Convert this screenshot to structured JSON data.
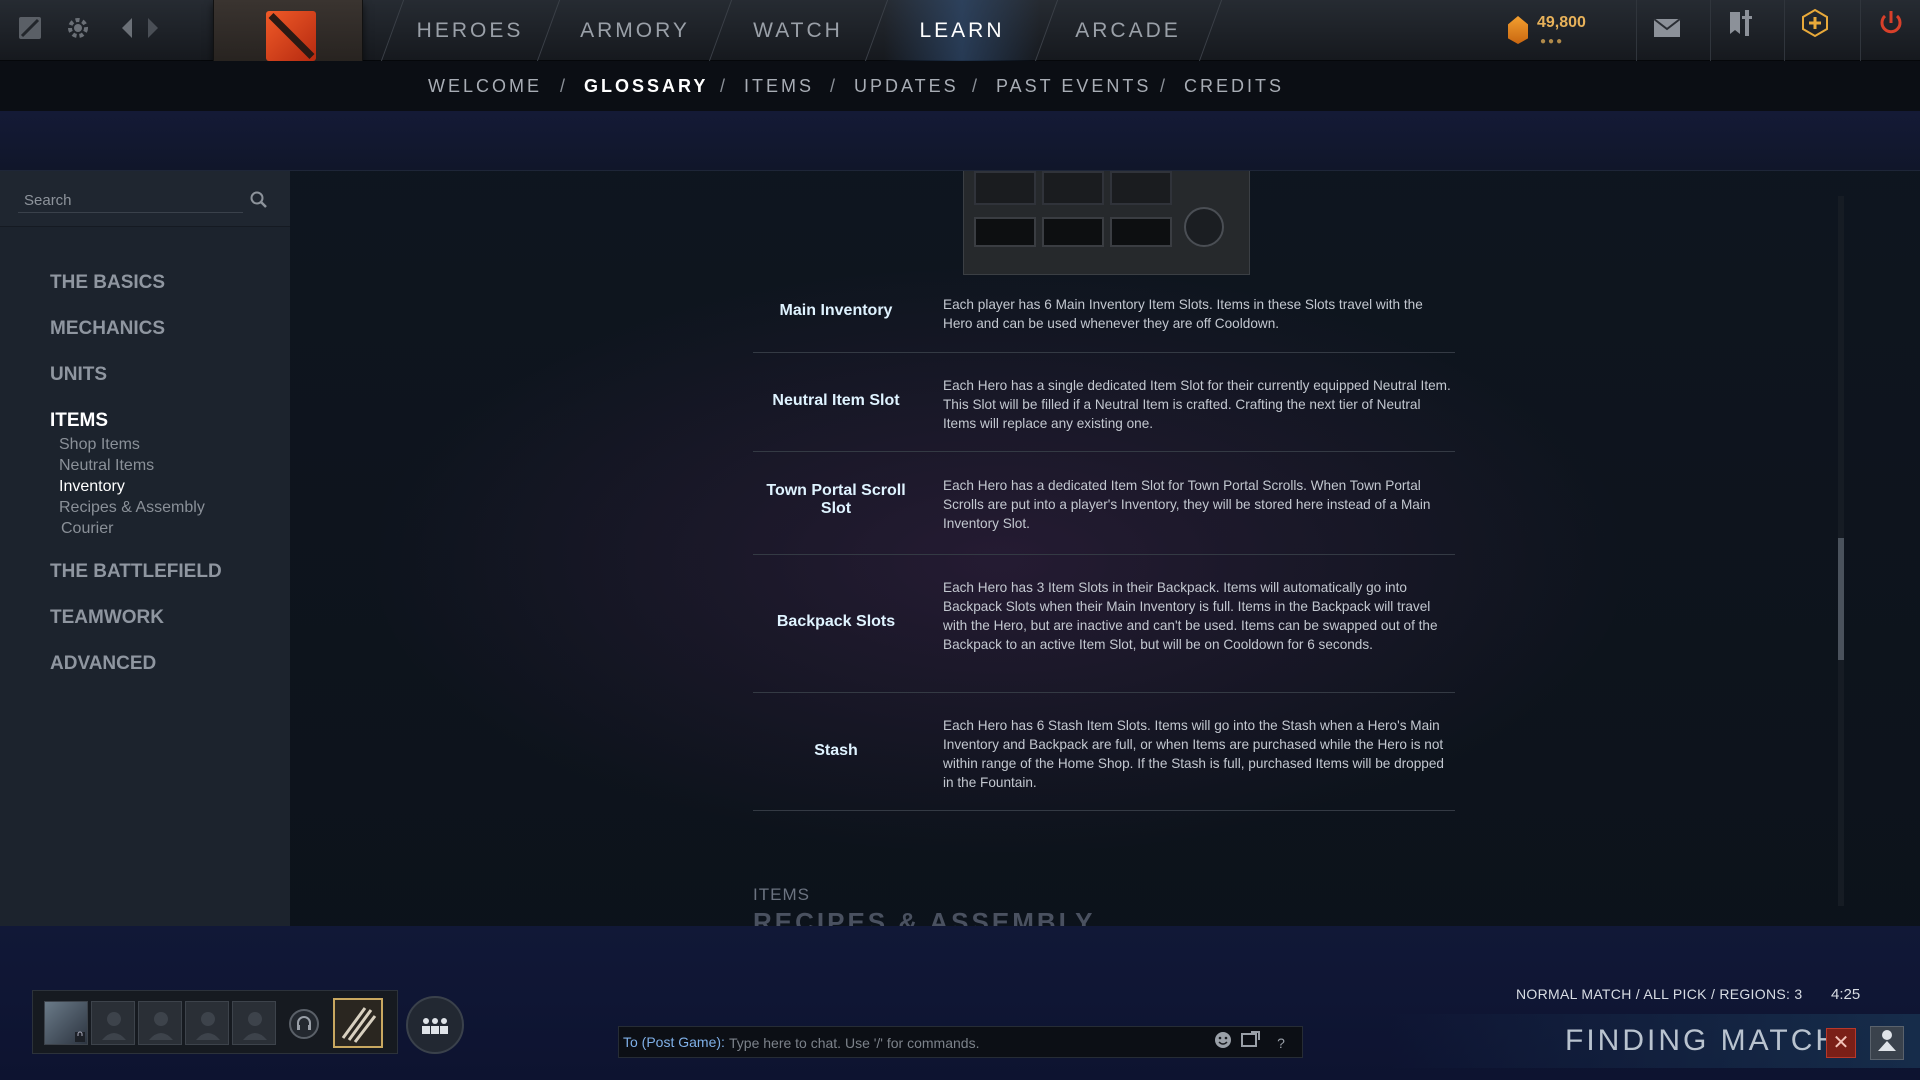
{
  "topnav": {
    "items": [
      {
        "label": "HEROES"
      },
      {
        "label": "ARMORY"
      },
      {
        "label": "WATCH"
      },
      {
        "label": "LEARN"
      },
      {
        "label": "ARCADE"
      }
    ],
    "active": "LEARN",
    "gold": "49,800"
  },
  "subnav": {
    "items": [
      {
        "label": "WELCOME"
      },
      {
        "label": "GLOSSARY"
      },
      {
        "label": "ITEMS"
      },
      {
        "label": "UPDATES"
      },
      {
        "label": "PAST EVENTS"
      },
      {
        "label": "CREDITS"
      }
    ],
    "separator": "/",
    "active": "GLOSSARY"
  },
  "sidebar": {
    "search_placeholder": "Search",
    "groups": [
      {
        "label": "THE BASICS"
      },
      {
        "label": "MECHANICS"
      },
      {
        "label": "UNITS"
      },
      {
        "label": "ITEMS"
      },
      {
        "label": "THE BATTLEFIELD"
      },
      {
        "label": "TEAMWORK"
      },
      {
        "label": "ADVANCED"
      }
    ],
    "items_subitems": [
      {
        "label": "Shop Items"
      },
      {
        "label": "Neutral Items"
      },
      {
        "label": "Inventory"
      },
      {
        "label": "Recipes & Assembly"
      },
      {
        "label": "Courier"
      }
    ],
    "active_group": "ITEMS",
    "active_sub": "Inventory"
  },
  "glossary": {
    "rows": [
      {
        "term": "Main Inventory",
        "desc": "Each player has 6 Main Inventory Item Slots.  Items in these Slots travel with the Hero and can be used whenever they are off Cooldown."
      },
      {
        "term": "Neutral Item Slot",
        "desc": "Each Hero has a single dedicated Item Slot for their currently equipped Neutral Item. This Slot will be filled if a Neutral Item is crafted. Crafting the next tier of Neutral Items will replace any existing one."
      },
      {
        "term": "Town Portal Scroll Slot",
        "desc": "Each Hero has a dedicated Item Slot for Town Portal Scrolls. When Town Portal Scrolls are put into a player's Inventory, they will be stored here instead of a Main Inventory Slot."
      },
      {
        "term": "Backpack Slots",
        "desc": "Each Hero has 3 Item Slots in their Backpack.  Items will automatically go into Backpack Slots when their Main Inventory is full. Items in the Backpack will travel with the Hero, but are inactive and can't be used.  Items can be swapped out of the Backpack to an active Item Slot, but will be on Cooldown for 6 seconds."
      },
      {
        "term": "Stash",
        "desc": "Each Hero has 6 Stash Item Slots.  Items will go into the Stash when a Hero's Main Inventory and Backpack are full, or when Items are purchased while the Hero is not within range of the Home Shop.  If the Stash is full, purchased Items will be dropped in the Fountain."
      }
    ],
    "next_section_head": "ITEMS",
    "next_section_title": "RECIPES & ASSEMBLY"
  },
  "chat": {
    "target": "To (Post Game):",
    "placeholder": "Type here to chat. Use '/' for commands.",
    "help": "?"
  },
  "matchmaking": {
    "info": "NORMAL MATCH / ALL PICK / REGIONS: 3",
    "time": "4:25",
    "status": "FINDING MATCH",
    "cancel": "✕"
  },
  "icons": {
    "dota-logo": "dota-icon",
    "settings": "gear-icon",
    "back": "back-arrow-icon",
    "forward": "forward-arrow-icon",
    "mail": "mail-icon",
    "armory": "shield-icon",
    "plus": "plus-icon",
    "power": "power-icon"
  },
  "colors": {
    "accent_gold": "#e8b25a",
    "link_blue": "#7fb0e8",
    "cancel_red": "#7a1f17",
    "term_color": "#dff3ff"
  }
}
